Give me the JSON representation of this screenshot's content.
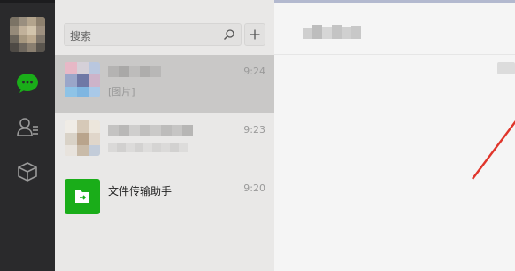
{
  "search": {
    "placeholder": "搜索"
  },
  "chats": [
    {
      "preview": "[图片]",
      "time": "9:24"
    },
    {
      "time": "9:23"
    },
    {
      "name": "文件传输助手",
      "time": "9:20"
    }
  ],
  "colors": {
    "rail": "#2a2a2c",
    "list_bg": "#e9e8e7",
    "active": "#c9c8c7",
    "accent_green": "#1aad19",
    "arrow": "#e0352b"
  },
  "icons": [
    "chat-bubble-icon",
    "contacts-icon",
    "favorites-cube-icon",
    "search-icon",
    "plus-icon",
    "folder-transfer-icon"
  ]
}
